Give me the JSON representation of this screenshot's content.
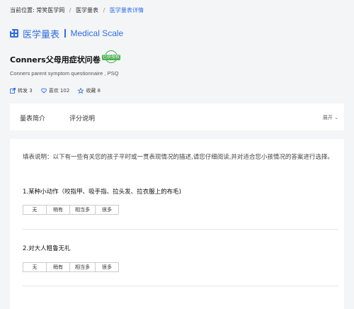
{
  "breadcrumb": {
    "prefix": "当前位置:",
    "site": "常笑医学网",
    "section": "医学量表",
    "current": "医学量表详情",
    "sep": "/"
  },
  "section_title": {
    "zh": "医学量表",
    "en": "Medical Scale"
  },
  "scale": {
    "title": "Conners父母用症状问卷",
    "badge": "已获授权",
    "subtitle": "Conners parent symptom questionnaire , PSQ"
  },
  "actions": {
    "share_label": "转发",
    "share_count": "3",
    "like_label": "喜欢",
    "like_count": "102",
    "fav_label": "收藏",
    "fav_count": "8"
  },
  "tabs": {
    "intro": "量表简介",
    "scoring": "评分说明",
    "expand": "展开"
  },
  "content": {
    "instructions": "填表说明：以下有一些有关您的孩子平时或一贯表现情况的描述,请您仔细阅读,并对适合您小孩情况的答案进行选择。",
    "questions": [
      {
        "text": "1.某种小动作（咬指甲、吸手指、拉头发、拉衣服上的布毛)",
        "options": [
          "无",
          "稍有",
          "相当多",
          "很多"
        ]
      },
      {
        "text": "2.对大人粗鲁无礼",
        "options": [
          "无",
          "稍有",
          "相当多",
          "很多"
        ]
      }
    ]
  },
  "colors": {
    "accent": "#2f6fe0",
    "badge": "#4caf50"
  },
  "icons": {
    "share": "share-icon",
    "like": "heart-icon",
    "fav": "star-icon",
    "expand": "chevron-down-icon",
    "section": "grid-icon"
  }
}
